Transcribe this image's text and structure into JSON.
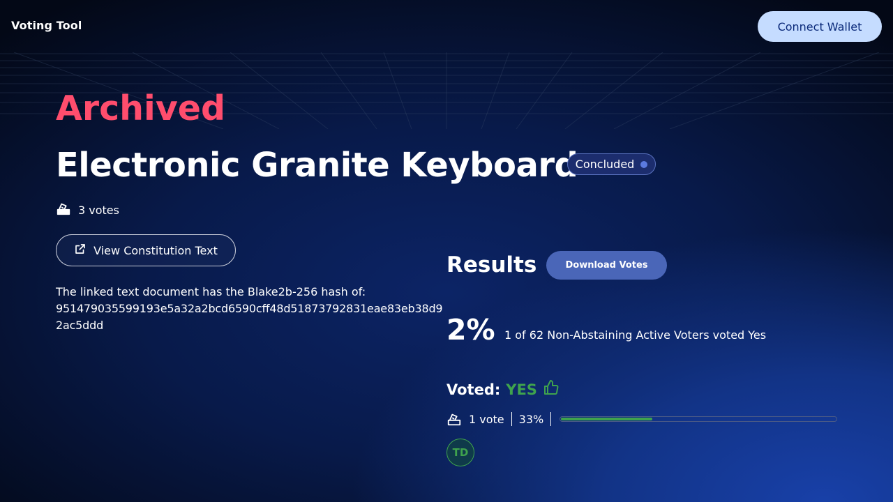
{
  "header": {
    "brand": "Voting Tool",
    "connect_label": "Connect Wallet"
  },
  "proposal": {
    "archived_label": "Archived",
    "title": "Electronic Granite Keyboard",
    "status": "Concluded",
    "votes_count": "3 votes",
    "view_button_label": "View Constitution Text",
    "hash_label": "The linked text document has the Blake2b-256 hash of:",
    "hash_value": "951479035599193e5a32a2bcd6590cff48d51873792831eae83eb38d92ac5ddd"
  },
  "results": {
    "title": "Results",
    "download_label": "Download Votes",
    "percent": "2%",
    "percent_desc": "1 of 62 Non-Abstaining Active Voters voted Yes",
    "voted_label": "Voted:",
    "voted_value": "YES",
    "vote_count": "1 vote",
    "vote_percent": "33%",
    "vote_progress": 0.33,
    "voter_initials": "TD"
  },
  "colors": {
    "archived": "#ff4d6d",
    "yes": "#3fa34d",
    "accent": "#4a66b8",
    "connect_bg": "#c5dcff"
  },
  "icons": {
    "ballot": "ballot-box-icon",
    "external": "external-link-icon",
    "thumbs_up": "thumbs-up-icon",
    "status_dot": "status-dot-icon"
  }
}
